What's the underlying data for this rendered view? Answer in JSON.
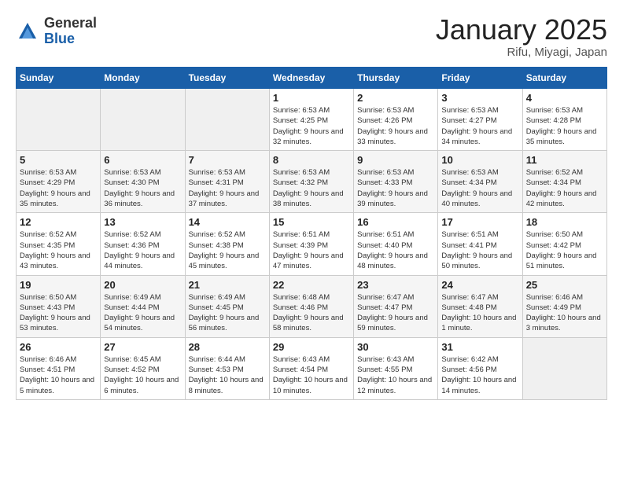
{
  "header": {
    "logo_general": "General",
    "logo_blue": "Blue",
    "title": "January 2025",
    "location": "Rifu, Miyagi, Japan"
  },
  "days_of_week": [
    "Sunday",
    "Monday",
    "Tuesday",
    "Wednesday",
    "Thursday",
    "Friday",
    "Saturday"
  ],
  "weeks": [
    [
      {
        "num": "",
        "info": ""
      },
      {
        "num": "",
        "info": ""
      },
      {
        "num": "",
        "info": ""
      },
      {
        "num": "1",
        "info": "Sunrise: 6:53 AM\nSunset: 4:25 PM\nDaylight: 9 hours and 32 minutes."
      },
      {
        "num": "2",
        "info": "Sunrise: 6:53 AM\nSunset: 4:26 PM\nDaylight: 9 hours and 33 minutes."
      },
      {
        "num": "3",
        "info": "Sunrise: 6:53 AM\nSunset: 4:27 PM\nDaylight: 9 hours and 34 minutes."
      },
      {
        "num": "4",
        "info": "Sunrise: 6:53 AM\nSunset: 4:28 PM\nDaylight: 9 hours and 35 minutes."
      }
    ],
    [
      {
        "num": "5",
        "info": "Sunrise: 6:53 AM\nSunset: 4:29 PM\nDaylight: 9 hours and 35 minutes."
      },
      {
        "num": "6",
        "info": "Sunrise: 6:53 AM\nSunset: 4:30 PM\nDaylight: 9 hours and 36 minutes."
      },
      {
        "num": "7",
        "info": "Sunrise: 6:53 AM\nSunset: 4:31 PM\nDaylight: 9 hours and 37 minutes."
      },
      {
        "num": "8",
        "info": "Sunrise: 6:53 AM\nSunset: 4:32 PM\nDaylight: 9 hours and 38 minutes."
      },
      {
        "num": "9",
        "info": "Sunrise: 6:53 AM\nSunset: 4:33 PM\nDaylight: 9 hours and 39 minutes."
      },
      {
        "num": "10",
        "info": "Sunrise: 6:53 AM\nSunset: 4:34 PM\nDaylight: 9 hours and 40 minutes."
      },
      {
        "num": "11",
        "info": "Sunrise: 6:52 AM\nSunset: 4:34 PM\nDaylight: 9 hours and 42 minutes."
      }
    ],
    [
      {
        "num": "12",
        "info": "Sunrise: 6:52 AM\nSunset: 4:35 PM\nDaylight: 9 hours and 43 minutes."
      },
      {
        "num": "13",
        "info": "Sunrise: 6:52 AM\nSunset: 4:36 PM\nDaylight: 9 hours and 44 minutes."
      },
      {
        "num": "14",
        "info": "Sunrise: 6:52 AM\nSunset: 4:38 PM\nDaylight: 9 hours and 45 minutes."
      },
      {
        "num": "15",
        "info": "Sunrise: 6:51 AM\nSunset: 4:39 PM\nDaylight: 9 hours and 47 minutes."
      },
      {
        "num": "16",
        "info": "Sunrise: 6:51 AM\nSunset: 4:40 PM\nDaylight: 9 hours and 48 minutes."
      },
      {
        "num": "17",
        "info": "Sunrise: 6:51 AM\nSunset: 4:41 PM\nDaylight: 9 hours and 50 minutes."
      },
      {
        "num": "18",
        "info": "Sunrise: 6:50 AM\nSunset: 4:42 PM\nDaylight: 9 hours and 51 minutes."
      }
    ],
    [
      {
        "num": "19",
        "info": "Sunrise: 6:50 AM\nSunset: 4:43 PM\nDaylight: 9 hours and 53 minutes."
      },
      {
        "num": "20",
        "info": "Sunrise: 6:49 AM\nSunset: 4:44 PM\nDaylight: 9 hours and 54 minutes."
      },
      {
        "num": "21",
        "info": "Sunrise: 6:49 AM\nSunset: 4:45 PM\nDaylight: 9 hours and 56 minutes."
      },
      {
        "num": "22",
        "info": "Sunrise: 6:48 AM\nSunset: 4:46 PM\nDaylight: 9 hours and 58 minutes."
      },
      {
        "num": "23",
        "info": "Sunrise: 6:47 AM\nSunset: 4:47 PM\nDaylight: 9 hours and 59 minutes."
      },
      {
        "num": "24",
        "info": "Sunrise: 6:47 AM\nSunset: 4:48 PM\nDaylight: 10 hours and 1 minute."
      },
      {
        "num": "25",
        "info": "Sunrise: 6:46 AM\nSunset: 4:49 PM\nDaylight: 10 hours and 3 minutes."
      }
    ],
    [
      {
        "num": "26",
        "info": "Sunrise: 6:46 AM\nSunset: 4:51 PM\nDaylight: 10 hours and 5 minutes."
      },
      {
        "num": "27",
        "info": "Sunrise: 6:45 AM\nSunset: 4:52 PM\nDaylight: 10 hours and 6 minutes."
      },
      {
        "num": "28",
        "info": "Sunrise: 6:44 AM\nSunset: 4:53 PM\nDaylight: 10 hours and 8 minutes."
      },
      {
        "num": "29",
        "info": "Sunrise: 6:43 AM\nSunset: 4:54 PM\nDaylight: 10 hours and 10 minutes."
      },
      {
        "num": "30",
        "info": "Sunrise: 6:43 AM\nSunset: 4:55 PM\nDaylight: 10 hours and 12 minutes."
      },
      {
        "num": "31",
        "info": "Sunrise: 6:42 AM\nSunset: 4:56 PM\nDaylight: 10 hours and 14 minutes."
      },
      {
        "num": "",
        "info": ""
      }
    ]
  ]
}
